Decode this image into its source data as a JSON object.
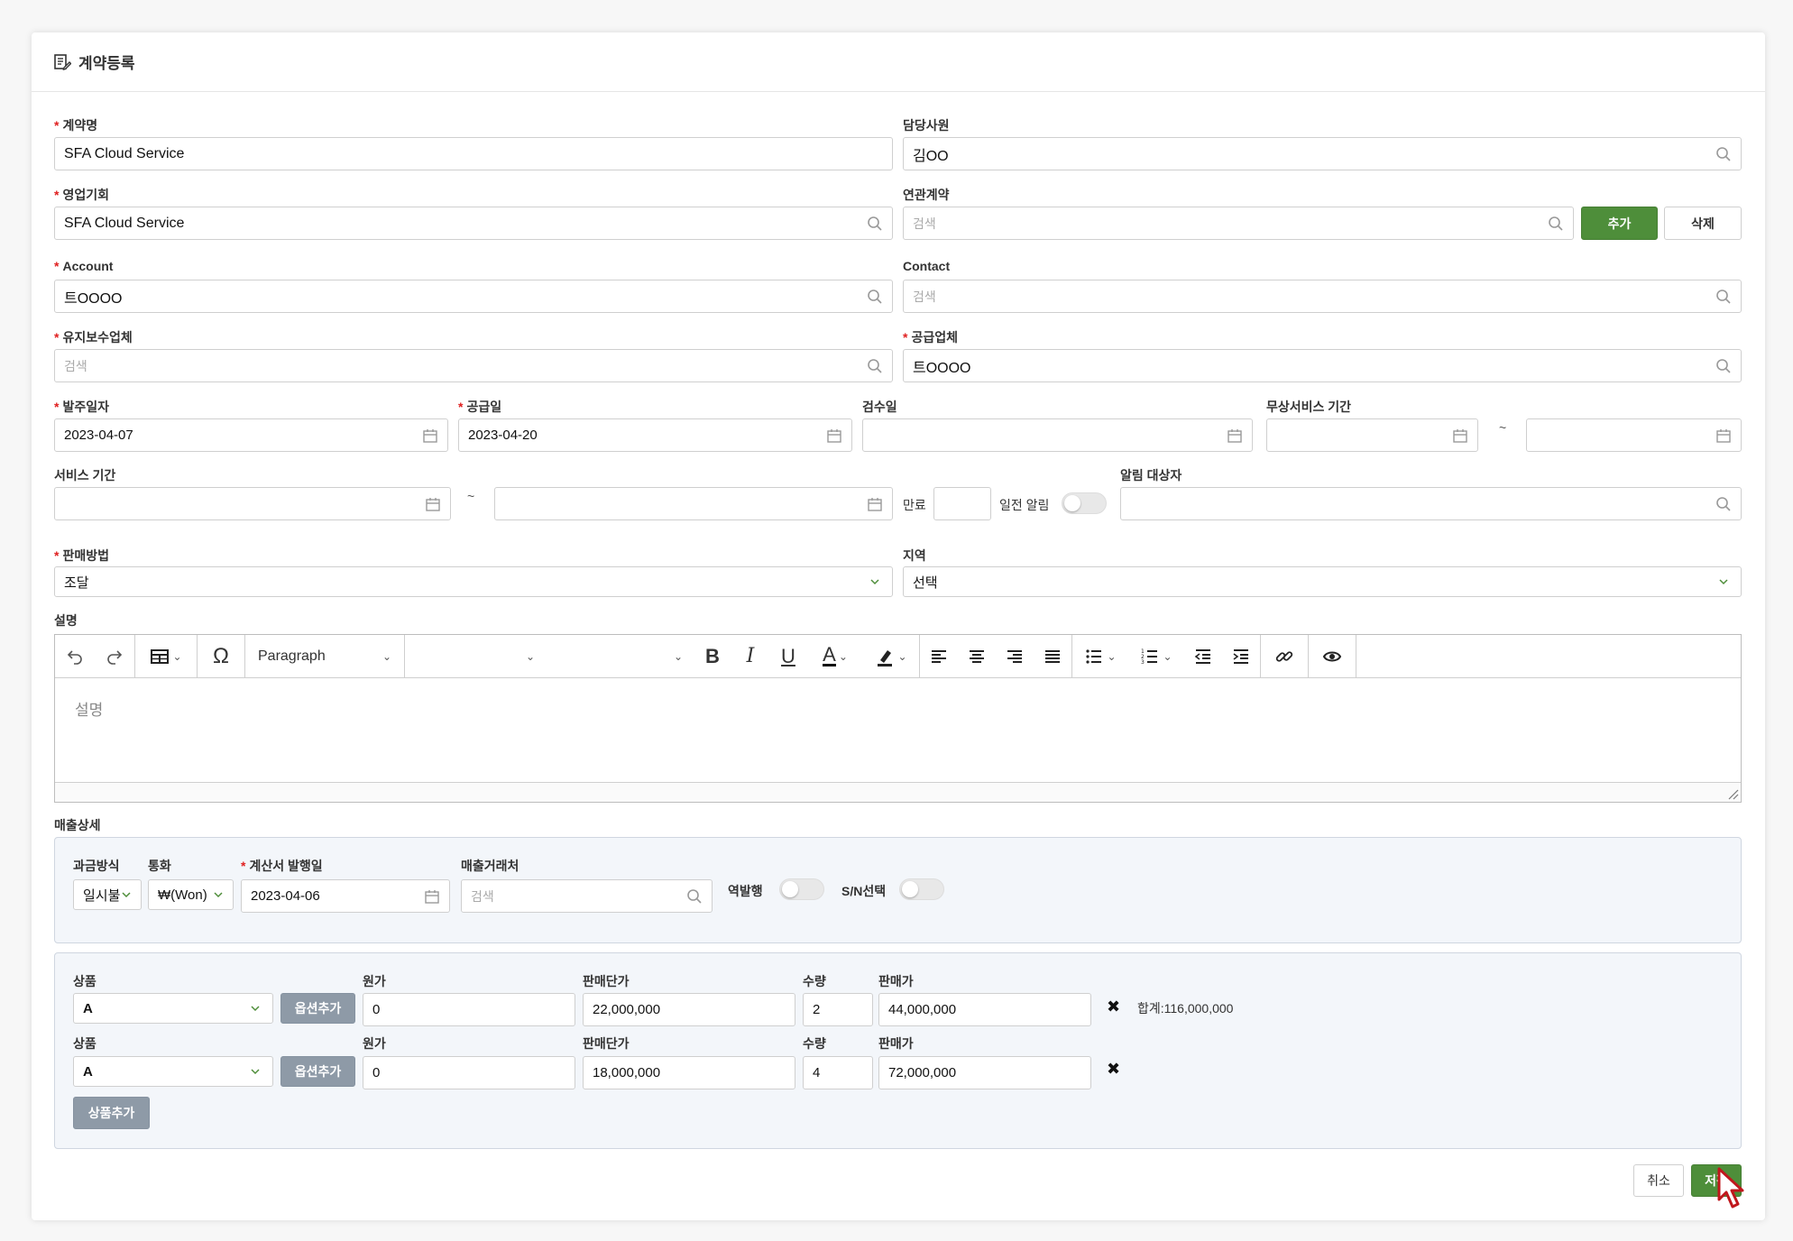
{
  "header": {
    "title": "계약등록"
  },
  "fields": {
    "contract_name": {
      "label": "계약명",
      "value": "SFA Cloud Service"
    },
    "staff": {
      "label": "담당사원",
      "value": "김OO"
    },
    "opportunity": {
      "label": "영업기회",
      "value": "SFA Cloud Service"
    },
    "related_contract": {
      "label": "연관계약",
      "placeholder": "검색",
      "add": "추가",
      "delete": "삭제"
    },
    "account": {
      "label": "Account",
      "value": "트OOOO"
    },
    "contact": {
      "label": "Contact",
      "placeholder": "검색"
    },
    "maintenance_vendor": {
      "label": "유지보수업체",
      "placeholder": "검색"
    },
    "supplier": {
      "label": "공급업체",
      "value": "트OOOO"
    },
    "order_date": {
      "label": "발주일자",
      "value": "2023-04-07"
    },
    "supply_date": {
      "label": "공급일",
      "value": "2023-04-20"
    },
    "inspection_date": {
      "label": "검수일",
      "value": ""
    },
    "free_service_period": {
      "label": "무상서비스 기간",
      "tilde": "~"
    },
    "service_period": {
      "label": "서비스 기간",
      "tilde": "~"
    },
    "expiry": {
      "label": "만료",
      "notify_label": "일전 알림"
    },
    "notify_target": {
      "label": "알림 대상자"
    },
    "sales_method": {
      "label": "판매방법",
      "value": "조달"
    },
    "region": {
      "label": "지역",
      "value": "선택"
    },
    "description": {
      "label": "설명",
      "placeholder": "설명"
    }
  },
  "editor": {
    "paragraph": "Paragraph"
  },
  "sales_detail": {
    "label": "매출상세",
    "billing_method": {
      "label": "과금방식",
      "value": "일시불"
    },
    "currency": {
      "label": "통화",
      "value": "₩(Won)"
    },
    "invoice_date": {
      "label": "계산서 발행일",
      "value": "2023-04-06"
    },
    "sales_partner": {
      "label": "매출거래처",
      "placeholder": "검색"
    },
    "reverse_issue": {
      "label": "역발행"
    },
    "sn_select": {
      "label": "S/N선택"
    }
  },
  "products": {
    "col_product": "상품",
    "col_cost": "원가",
    "col_unit_price": "판매단가",
    "col_qty": "수량",
    "col_price": "판매가",
    "option_add": "옵션추가",
    "product_add": "상품추가",
    "total": "합계:116,000,000",
    "rows": [
      {
        "product": "A",
        "cost": "0",
        "unit_price": "22,000,000",
        "qty": "2",
        "price": "44,000,000"
      },
      {
        "product": "A",
        "cost": "0",
        "unit_price": "18,000,000",
        "qty": "4",
        "price": "72,000,000"
      }
    ]
  },
  "footer": {
    "cancel": "취소",
    "save": "저장"
  },
  "colors": {
    "accent_green": "#4e8e3a",
    "required_red": "#e02020",
    "gray_button": "#8e9aa7"
  }
}
